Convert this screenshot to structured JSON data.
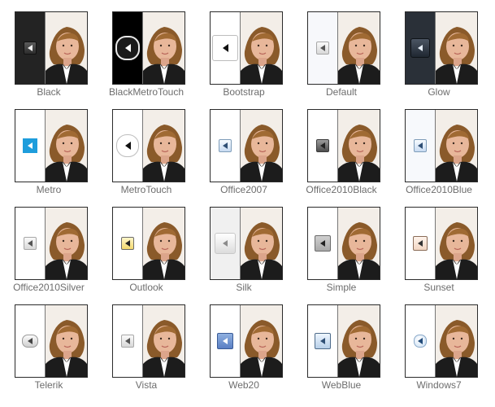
{
  "skins": [
    {
      "name": "Black",
      "pane": "#232323",
      "btn": "square-dark",
      "icon": "chevron-left-icon"
    },
    {
      "name": "BlackMetroTouch",
      "pane": "#000000",
      "btn": "circle-dark",
      "icon": "chevron-left-icon"
    },
    {
      "name": "Bootstrap",
      "pane": "#ffffff",
      "btn": "square-outline",
      "icon": "chevron-left-icon"
    },
    {
      "name": "Default",
      "pane": "#f7f8fb",
      "btn": "square-grey",
      "icon": "chevron-left-icon"
    },
    {
      "name": "Glow",
      "pane": "#2a3038",
      "btn": "square-glow",
      "icon": "chevron-left-icon"
    },
    {
      "name": "Metro",
      "pane": "#ffffff",
      "btn": "square-blue",
      "icon": "chevron-left-icon"
    },
    {
      "name": "MetroTouch",
      "pane": "#ffffff",
      "btn": "circle-outline",
      "icon": "chevron-left-icon"
    },
    {
      "name": "Office2007",
      "pane": "#ffffff",
      "btn": "square-lightblue",
      "icon": "chevron-left-icon"
    },
    {
      "name": "Office2010Black",
      "pane": "#ffffff",
      "btn": "square-darkgrad",
      "icon": "chevron-left-icon"
    },
    {
      "name": "Office2010Blue",
      "pane": "#f7f9fc",
      "btn": "square-lightblue",
      "icon": "chevron-left-icon"
    },
    {
      "name": "Office2010Silver",
      "pane": "#ffffff",
      "btn": "square-grey",
      "icon": "chevron-left-icon"
    },
    {
      "name": "Outlook",
      "pane": "#ffffff",
      "btn": "square-yellow",
      "icon": "chevron-left-icon"
    },
    {
      "name": "Silk",
      "pane": "#f0f0f0",
      "btn": "square-silk",
      "icon": "chevron-left-icon"
    },
    {
      "name": "Simple",
      "pane": "#ffffff",
      "btn": "square-grey-bold",
      "icon": "chevron-left-icon"
    },
    {
      "name": "Sunset",
      "pane": "#ffffff",
      "btn": "square-peach",
      "icon": "chevron-left-icon"
    },
    {
      "name": "Telerik",
      "pane": "#ffffff",
      "btn": "pill-grey",
      "icon": "chevron-left-icon"
    },
    {
      "name": "Vista",
      "pane": "#ffffff",
      "btn": "square-grey",
      "icon": "chevron-left-icon"
    },
    {
      "name": "Web20",
      "pane": "#ffffff",
      "btn": "square-blue20",
      "icon": "chevron-left-icon"
    },
    {
      "name": "WebBlue",
      "pane": "#ffffff",
      "btn": "square-webblue",
      "icon": "chevron-left-icon"
    },
    {
      "name": "Windows7",
      "pane": "#ffffff",
      "btn": "circle-win7",
      "icon": "chevron-left-icon"
    }
  ]
}
